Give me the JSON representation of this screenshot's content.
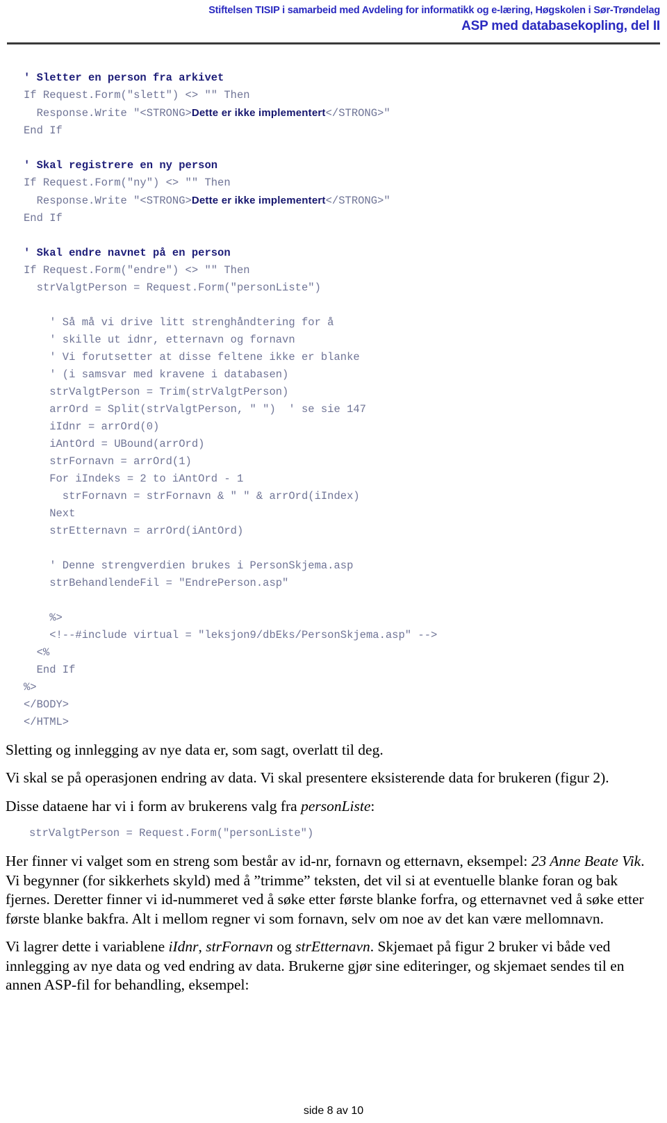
{
  "header": {
    "line1": "Stiftelsen TISIP i samarbeid med Avdeling for informatikk og e-læring, Høgskolen i Sør-Trøndelag",
    "line2": "ASP med databasekopling, del II"
  },
  "code_block": {
    "lines": [
      {
        "type": "comment-bold",
        "text": "' Sletter en person fra arkivet"
      },
      {
        "type": "code",
        "text": "If Request.Form(\"slett\") <> \"\" Then"
      },
      {
        "type": "code-strong",
        "pre": "  Response.Write \"<STRONG>",
        "strong": "Dette er ikke implementert",
        "post": "</STRONG>\""
      },
      {
        "type": "code",
        "text": "End If"
      },
      {
        "type": "blank",
        "text": ""
      },
      {
        "type": "comment-bold",
        "text": "' Skal registrere en ny person"
      },
      {
        "type": "code",
        "text": "If Request.Form(\"ny\") <> \"\" Then"
      },
      {
        "type": "code-strong",
        "pre": "  Response.Write \"<STRONG>",
        "strong": "Dette er ikke implementert",
        "post": "</STRONG>\""
      },
      {
        "type": "code",
        "text": "End If"
      },
      {
        "type": "blank",
        "text": ""
      },
      {
        "type": "comment-bold",
        "text": "' Skal endre navnet på en person"
      },
      {
        "type": "code",
        "text": "If Request.Form(\"endre\") <> \"\" Then"
      },
      {
        "type": "code",
        "text": "  strValgtPerson = Request.Form(\"personListe\")"
      },
      {
        "type": "blank",
        "text": ""
      },
      {
        "type": "code",
        "text": "    ' Så må vi drive litt strenghåndtering for å"
      },
      {
        "type": "code",
        "text": "    ' skille ut idnr, etternavn og fornavn"
      },
      {
        "type": "code",
        "text": "    ' Vi forutsetter at disse feltene ikke er blanke"
      },
      {
        "type": "code",
        "text": "    ' (i samsvar med kravene i databasen)"
      },
      {
        "type": "code",
        "text": "    strValgtPerson = Trim(strValgtPerson)"
      },
      {
        "type": "code",
        "text": "    arrOrd = Split(strValgtPerson, \" \")  ' se sie 147"
      },
      {
        "type": "code",
        "text": "    iIdnr = arrOrd(0)"
      },
      {
        "type": "code",
        "text": "    iAntOrd = UBound(arrOrd)"
      },
      {
        "type": "code",
        "text": "    strFornavn = arrOrd(1)"
      },
      {
        "type": "code",
        "text": "    For iIndeks = 2 to iAntOrd - 1"
      },
      {
        "type": "code",
        "text": "      strFornavn = strFornavn & \" \" & arrOrd(iIndex)"
      },
      {
        "type": "code",
        "text": "    Next"
      },
      {
        "type": "code",
        "text": "    strEtternavn = arrOrd(iAntOrd)"
      },
      {
        "type": "blank",
        "text": ""
      },
      {
        "type": "code",
        "text": "    ' Denne strengverdien brukes i PersonSkjema.asp"
      },
      {
        "type": "code",
        "text": "    strBehandlendeFil = \"EndrePerson.asp\""
      },
      {
        "type": "blank",
        "text": ""
      },
      {
        "type": "code",
        "text": "    %>"
      },
      {
        "type": "code",
        "text": "    <!--#include virtual = \"leksjon9/dbEks/PersonSkjema.asp\" -->"
      },
      {
        "type": "code",
        "text": "  <%"
      },
      {
        "type": "code",
        "text": "  End If"
      },
      {
        "type": "code",
        "text": "%>"
      },
      {
        "type": "code",
        "text": "</BODY>"
      },
      {
        "type": "code",
        "text": "</HTML>"
      }
    ]
  },
  "body": {
    "para1": "Sletting og innlegging av nye data er, som sagt, overlatt til deg.",
    "para2": "Vi skal se på operasjonen endring av data. Vi skal presentere eksisterende data for brukeren (figur 2).",
    "para3_pre": "Disse dataene har vi i form av brukerens valg fra ",
    "para3_em": "personListe",
    "para3_post": ":",
    "snippet": "strValgtPerson = Request.Form(\"personListe\")",
    "para4_pre": "Her finner vi valget som en streng som består av id-nr, fornavn og etternavn, eksempel: ",
    "para4_em": "23 Anne Beate Vik",
    "para4_post": ". Vi begynner (for sikkerhets skyld) med å ”trimme” teksten, det vil si at eventuelle blanke foran og bak fjernes. Deretter finner vi id-nummeret ved å søke etter første blanke forfra, og etternavnet ved å søke etter første blanke bakfra. Alt i mellom regner vi som fornavn, selv om noe av det kan være mellomnavn.",
    "para5_pre": "Vi lagrer dette i variablene ",
    "para5_em1": "iIdnr",
    "para5_mid1": ", ",
    "para5_em2": "strFornavn",
    "para5_mid2": " og ",
    "para5_em3": "strEtternavn",
    "para5_post": ". Skjemaet på figur 2 bruker vi både ved innlegging av nye data og ved endring av data. Brukerne gjør sine editeringer, og skjemaet sendes til en annen ASP-fil for behandling, eksempel:"
  },
  "footer": {
    "page_label": "side 8 av 10"
  },
  "colors": {
    "header_blue": "#2a2ac0",
    "code_gray": "#6f7496",
    "comment_navy": "#1d1d78",
    "rule_dark": "#3a3a3a",
    "body_black": "#000000"
  }
}
